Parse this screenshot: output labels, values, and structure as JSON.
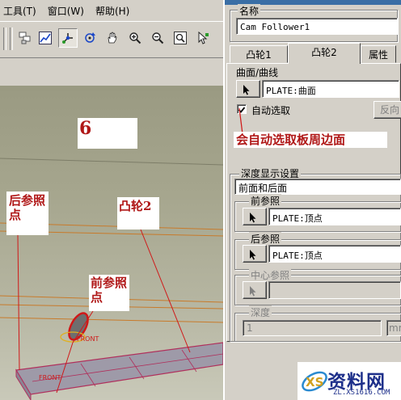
{
  "menu": {
    "items": [
      "工具(T)",
      "窗口(W)",
      "帮助(H)"
    ]
  },
  "toolbar": {
    "icons": [
      "layer-icon",
      "graph-icon",
      "node-connect-icon",
      "rotate-icon",
      "pan-hand-icon",
      "zoom-in-icon",
      "zoom-out-icon",
      "zoom-fit-icon",
      "cursor-select-icon"
    ]
  },
  "viewport": {
    "annotations": {
      "step": "6",
      "rear_ref": "后参照点",
      "cam2": "凸轮2",
      "front_ref": "前参照点",
      "auto_select": "会自动选取板周边面"
    },
    "model_tag_top": "FRONT",
    "model_tag_bottom": "FRONT"
  },
  "dialog": {
    "name_label": "名称",
    "name_value": "Cam Follower1",
    "tabs": [
      "凸轮1",
      "凸轮2",
      "属性"
    ],
    "active_tab": "凸轮2",
    "surface_group": "曲面/曲线",
    "surface_value": "PLATE:曲面",
    "auto_select_label": "自动选取",
    "auto_select_checked": true,
    "reverse_button": "反向",
    "depth_group": "深度显示设置",
    "depth_value": "前面和后面",
    "front_ref_label": "前参照",
    "front_ref_value": "PLATE:顶点",
    "rear_ref_label": "后参照",
    "rear_ref_value": "PLATE:顶点",
    "center_ref_label": "中心参照",
    "center_ref_value": "",
    "depth_label": "深度",
    "depth_value_num": "1",
    "depth_unit": "mm"
  },
  "watermark": {
    "name": "资料网",
    "url": "ZL.XS1616.COM"
  }
}
